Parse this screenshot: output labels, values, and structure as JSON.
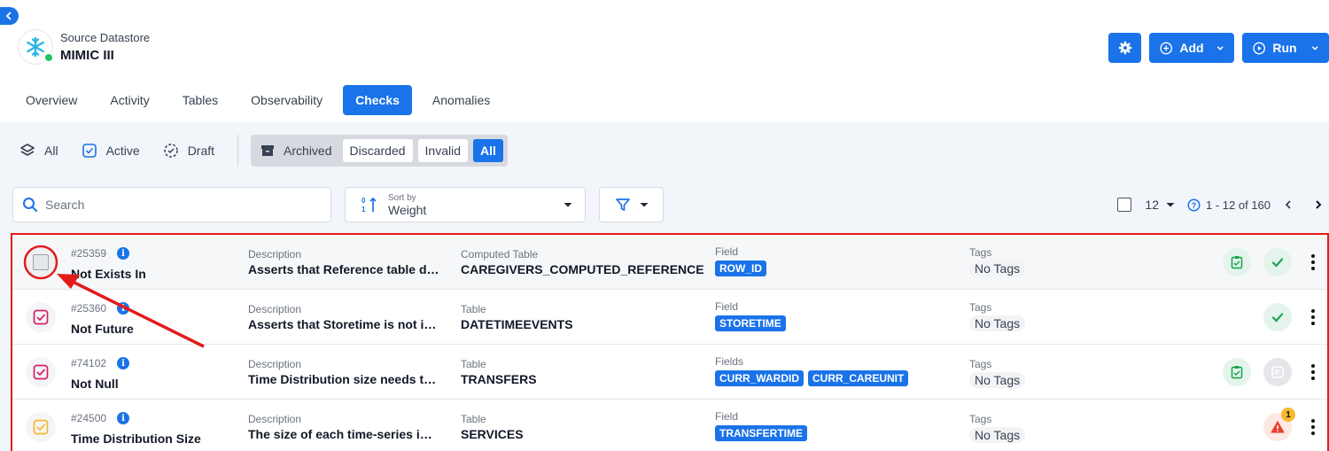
{
  "datastore": {
    "type_label": "Source Datastore",
    "name": "MIMIC III"
  },
  "actions": {
    "add_label": "Add",
    "run_label": "Run"
  },
  "tabs": [
    {
      "label": "Overview"
    },
    {
      "label": "Activity"
    },
    {
      "label": "Tables"
    },
    {
      "label": "Observability"
    },
    {
      "label": "Checks",
      "active": true
    },
    {
      "label": "Anomalies"
    }
  ],
  "status_filters": {
    "all": "All",
    "active": "Active",
    "draft": "Draft",
    "archived": "Archived",
    "discarded": "Discarded",
    "invalid": "Invalid",
    "all2": "All"
  },
  "search": {
    "placeholder": "Search"
  },
  "sort": {
    "caption": "Sort by",
    "value": "Weight"
  },
  "pager": {
    "per_page": "12",
    "range": "1 - 12 of 160"
  },
  "checks": [
    {
      "id": "#25359",
      "name": "Not Exists In",
      "desc_label": "Description",
      "desc": "Asserts that Reference table doe...",
      "table_label": "Computed Table",
      "table": "CAREGIVERS_COMPUTED_REFERENCE",
      "field_label": "Field",
      "fields": [
        "ROW_ID"
      ],
      "tags_label": "Tags",
      "tags": "No Tags"
    },
    {
      "id": "#25360",
      "name": "Not Future",
      "desc_label": "Description",
      "desc": "Asserts that Storetime is not in fu...",
      "table_label": "Table",
      "table": "DATETIMEEVENTS",
      "field_label": "Field",
      "fields": [
        "STORETIME"
      ],
      "tags_label": "Tags",
      "tags": "No Tags"
    },
    {
      "id": "#74102",
      "name": "Not Null",
      "desc_label": "Description",
      "desc": "Time Distribution size needs to be...",
      "table_label": "Table",
      "table": "TRANSFERS",
      "field_label": "Fields",
      "fields": [
        "CURR_WARDID",
        "CURR_CAREUNIT"
      ],
      "tags_label": "Tags",
      "tags": "No Tags"
    },
    {
      "id": "#24500",
      "name": "Time Distribution Size",
      "desc_label": "Description",
      "desc": "The size of each time-series inter...",
      "table_label": "Table",
      "table": "SERVICES",
      "field_label": "Field",
      "fields": [
        "TRANSFERTIME"
      ],
      "tags_label": "Tags",
      "tags": "No Tags",
      "anomaly_count": "1"
    }
  ],
  "colors": {
    "primary": "#1a73e8",
    "success": "#22c55e",
    "warning": "#f5b82e",
    "danger": "#e8402e",
    "highlight": "#e31b1b",
    "check_pink": "#d61f69"
  }
}
